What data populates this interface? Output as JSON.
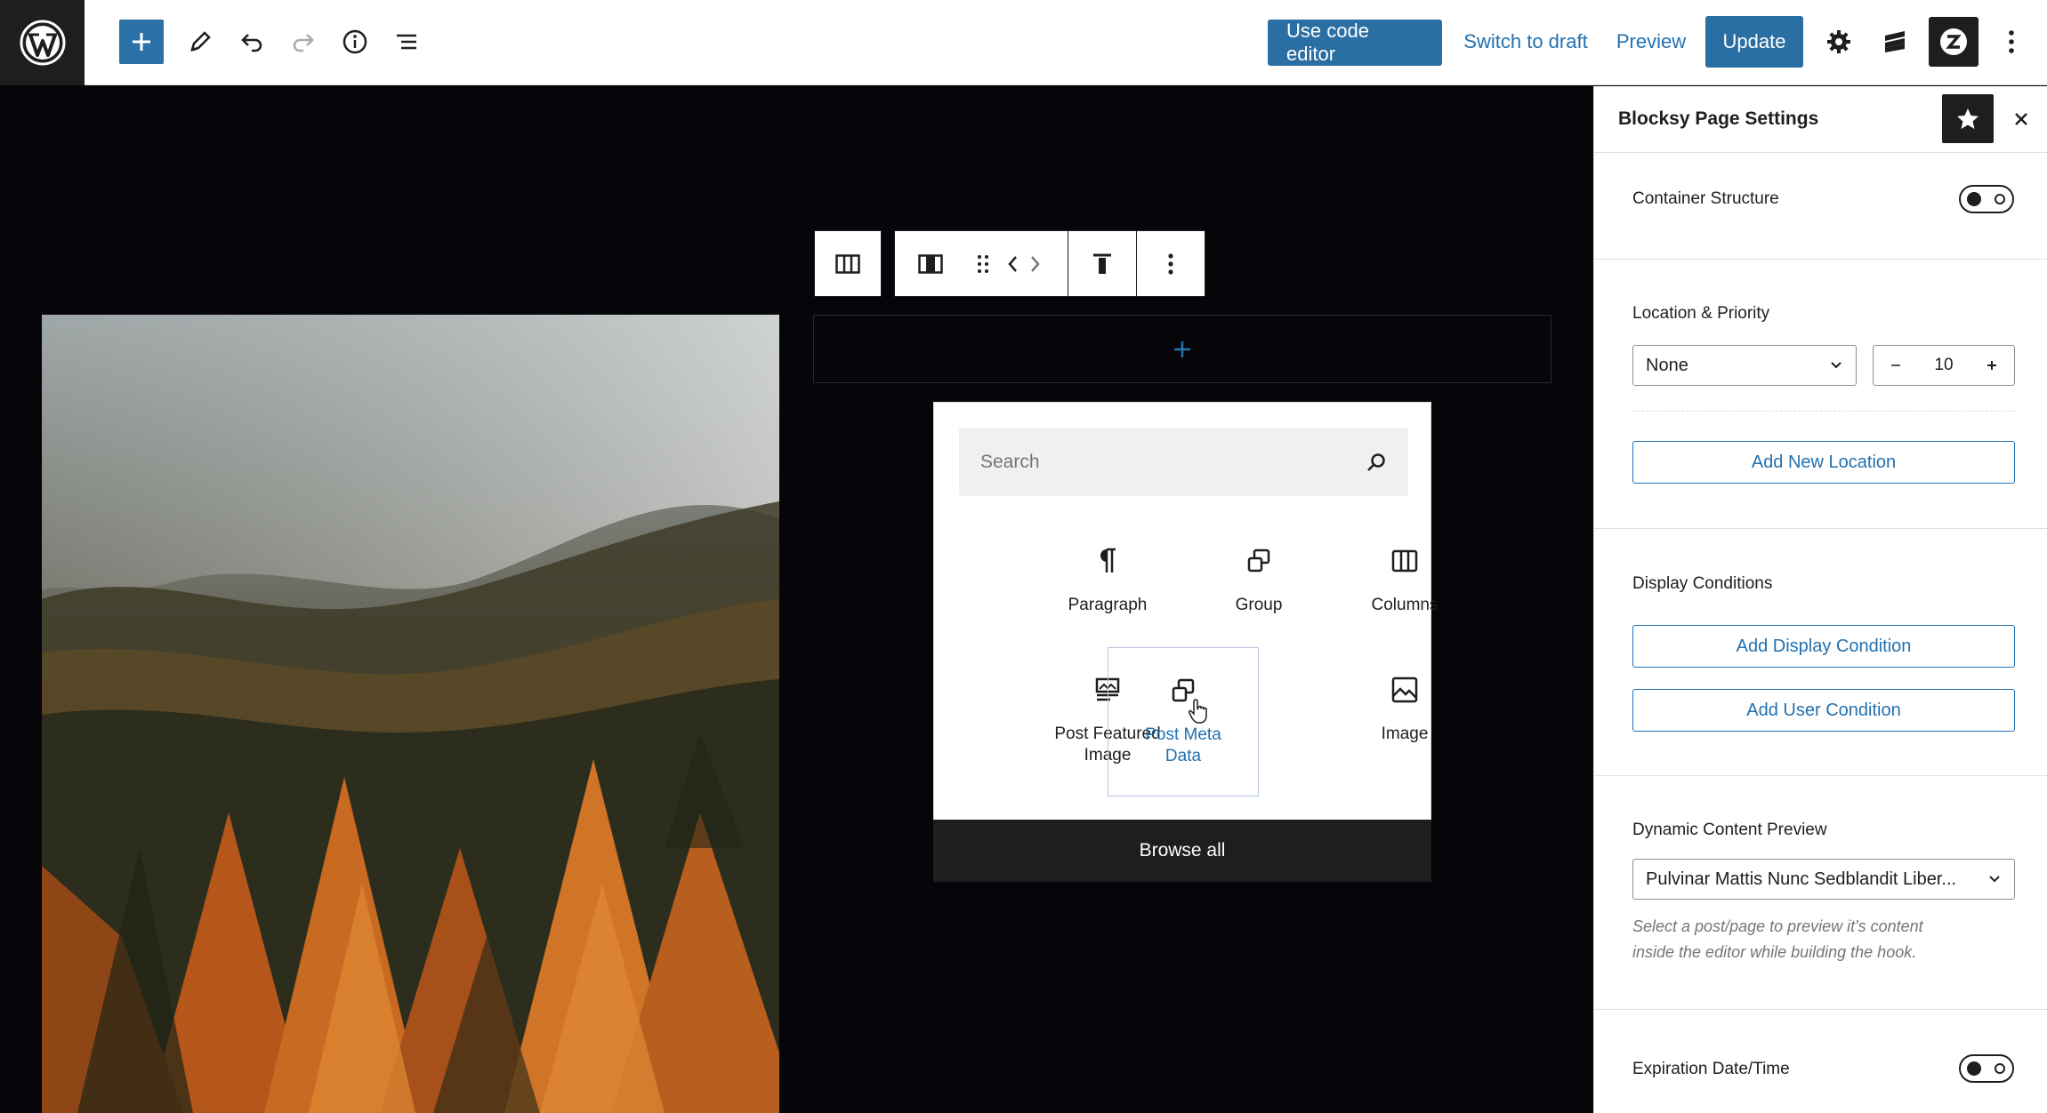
{
  "topbar": {
    "logo": "wordpress-logo",
    "use_code_editor": "Use code editor",
    "switch_to_draft": "Switch to draft",
    "preview": "Preview",
    "update": "Update",
    "icons": [
      "plus-icon",
      "pencil-icon",
      "undo-icon",
      "redo-icon",
      "info-icon",
      "list-view-icon",
      "gear-icon",
      "blocksy-icon",
      "plugin-icon",
      "more-vertical-icon"
    ]
  },
  "block_toolbar": {
    "icons": [
      "columns-icon",
      "column-icon",
      "drag-handle-icon",
      "move-left-icon",
      "move-right-icon",
      "align-top-icon",
      "more-vertical-icon"
    ]
  },
  "inserter": {
    "search_placeholder": "Search",
    "blocks": [
      {
        "label": "Paragraph",
        "icon": "paragraph-icon"
      },
      {
        "label": "Group",
        "icon": "group-icon"
      },
      {
        "label": "Columns",
        "icon": "columns-icon"
      },
      {
        "label": "Post Featured Image",
        "line1": "Post Featured",
        "line2": "Image",
        "icon": "post-featured-image-icon"
      },
      {
        "label": "Post Meta Data",
        "line1": "Post Meta",
        "line2": "Data",
        "icon": "post-meta-data-icon"
      },
      {
        "label": "Image",
        "icon": "image-icon"
      }
    ],
    "browse_all": "Browse all"
  },
  "sidebar": {
    "title": "Blocksy Page Settings",
    "container_structure": {
      "label": "Container Structure",
      "enabled": false
    },
    "location_priority": {
      "label": "Location & Priority",
      "location_value": "None",
      "priority_value": "10",
      "add_location": "Add New Location"
    },
    "display_conditions": {
      "label": "Display Conditions",
      "add_display": "Add Display Condition",
      "add_user": "Add User Condition"
    },
    "dynamic_preview": {
      "label": "Dynamic Content Preview",
      "value": "Pulvinar Mattis Nunc Sedblandit Liber...",
      "help_line1": "Select a post/page to preview it's content",
      "help_line2": "inside the editor while building the hook."
    },
    "expiration": {
      "label": "Expiration Date/Time",
      "enabled": false
    }
  },
  "colors": {
    "accent": "#2271b1",
    "primary_button": "#2a6fa3",
    "dark": "#1e1e1e",
    "canvas": "#05050a"
  }
}
